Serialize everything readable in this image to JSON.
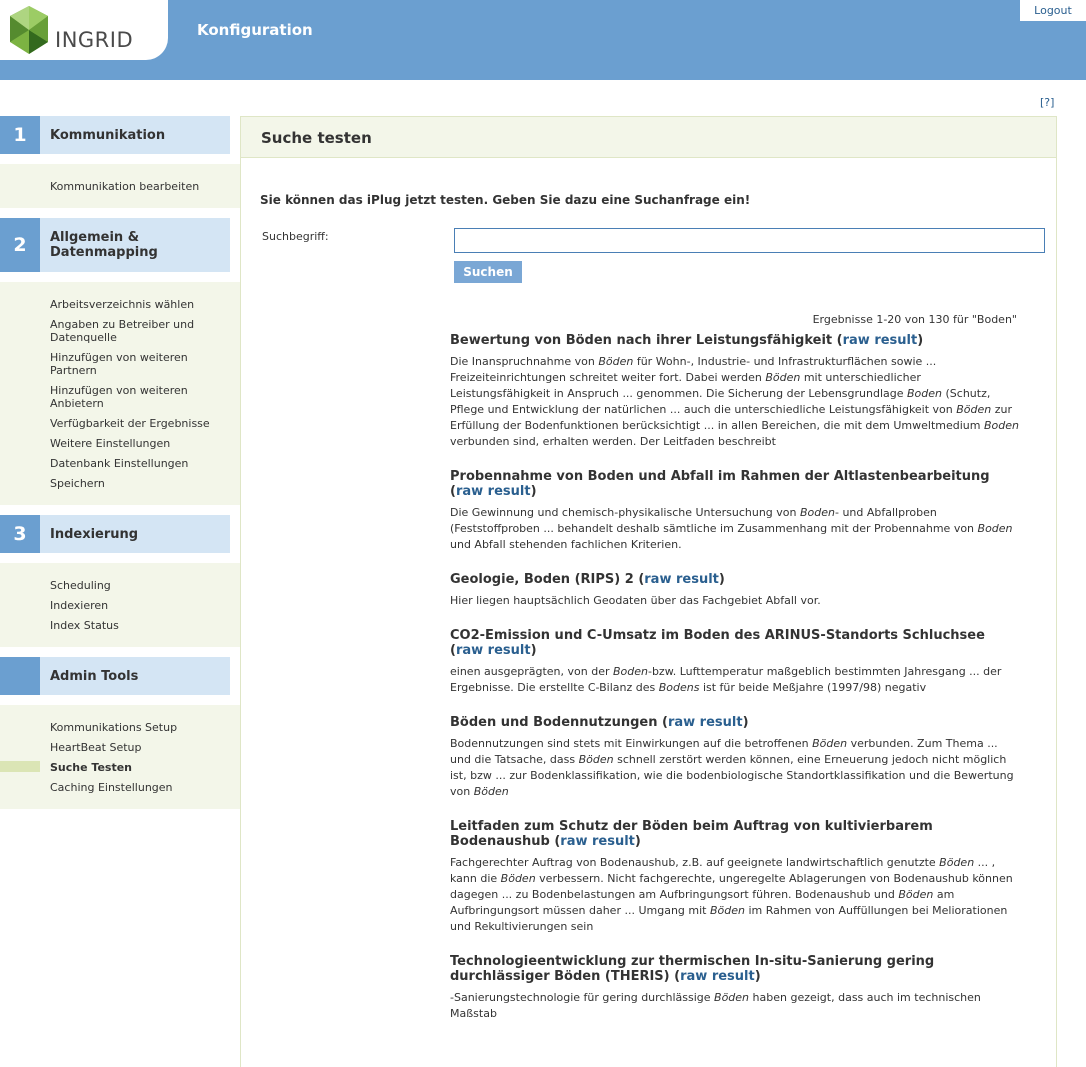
{
  "header": {
    "logo_text": "INGRID",
    "title": "Konfiguration",
    "logout": "Logout",
    "brand_colors": {
      "header": "#6b9fd0",
      "logo_green": "#7cb342"
    }
  },
  "help_link": "[?]",
  "sidebar": {
    "sections": [
      {
        "number": "1",
        "title": "Kommunikation",
        "items": [
          {
            "label": "Kommunikation bearbeiten",
            "active": false
          }
        ]
      },
      {
        "number": "2",
        "title": "Allgemein & Datenmapping",
        "items": [
          {
            "label": "Arbeitsverzeichnis wählen",
            "active": false
          },
          {
            "label": "Angaben zu Betreiber und Datenquelle",
            "active": false
          },
          {
            "label": "Hinzufügen von weiteren Partnern",
            "active": false
          },
          {
            "label": "Hinzufügen von weiteren Anbietern",
            "active": false
          },
          {
            "label": "Verfügbarkeit der Ergebnisse",
            "active": false
          },
          {
            "label": "Weitere Einstellungen",
            "active": false
          },
          {
            "label": "Datenbank Einstellungen",
            "active": false
          },
          {
            "label": "Speichern",
            "active": false
          }
        ]
      },
      {
        "number": "3",
        "title": "Indexierung",
        "items": [
          {
            "label": "Scheduling",
            "active": false
          },
          {
            "label": "Indexieren",
            "active": false
          },
          {
            "label": "Index Status",
            "active": false
          }
        ]
      },
      {
        "number": "",
        "title": "Admin Tools",
        "items": [
          {
            "label": "Kommunikations Setup",
            "active": false
          },
          {
            "label": "HeartBeat Setup",
            "active": false
          },
          {
            "label": "Suche Testen",
            "active": true
          },
          {
            "label": "Caching Einstellungen",
            "active": false
          }
        ]
      }
    ]
  },
  "main": {
    "heading": "Suche testen",
    "intro": "Sie können das iPlug jetzt testen. Geben Sie dazu eine Suchanfrage ein!",
    "search_label": "Suchbegriff:",
    "search_value": "",
    "search_button": "Suchen",
    "result_count": "Ergebnisse 1-20 von 130 für \"Boden\"",
    "raw_label": "raw result",
    "results": [
      {
        "title": "Bewertung von Böden nach ihrer Leistungsfähigkeit",
        "snippet": [
          {
            "t": "Die Inanspruchnahme von "
          },
          {
            "t": "Böden",
            "i": true
          },
          {
            "t": " für Wohn-, Industrie- und Infrastrukturflächen sowie ... Freizeiteinrichtungen schreitet weiter fort. Dabei werden "
          },
          {
            "t": "Böden",
            "i": true
          },
          {
            "t": " mit unterschiedlicher Leistungsfähigkeit in Anspruch ... genommen. Die Sicherung der Lebensgrundlage "
          },
          {
            "t": "Boden",
            "i": true
          },
          {
            "t": " (Schutz, Pflege und Entwicklung der natürlichen ... auch die unterschiedliche Leistungsfähigkeit von "
          },
          {
            "t": "Böden",
            "i": true
          },
          {
            "t": " zur Erfüllung der Bodenfunktionen berücksichtigt ... in allen Bereichen, die mit dem Umweltmedium "
          },
          {
            "t": "Boden",
            "i": true
          },
          {
            "t": " verbunden sind, erhalten werden. Der Leitfaden beschreibt"
          }
        ]
      },
      {
        "title": "Probennahme von Boden und Abfall im Rahmen der Altlastenbearbeitung",
        "snippet": [
          {
            "t": "Die Gewinnung und chemisch-physikalische Untersuchung von "
          },
          {
            "t": "Boden",
            "i": true
          },
          {
            "t": "- und Abfallproben (Feststoffproben ... behandelt deshalb sämtliche im Zusammenhang mit der Probennahme von "
          },
          {
            "t": "Boden",
            "i": true
          },
          {
            "t": " und Abfall stehenden fachlichen Kriterien."
          }
        ]
      },
      {
        "title": "Geologie, Boden (RIPS) 2",
        "snippet": [
          {
            "t": "Hier liegen hauptsächlich Geodaten über das Fachgebiet Abfall vor."
          }
        ]
      },
      {
        "title": "CO2-Emission und C-Umsatz im Boden des ARINUS-Standorts Schluchsee",
        "snippet": [
          {
            "t": "einen ausgeprägten, von der "
          },
          {
            "t": "Boden",
            "i": true
          },
          {
            "t": "-bzw. Lufttemperatur maßgeblich bestimmten Jahresgang ... der Ergebnisse. Die erstellte C-Bilanz des "
          },
          {
            "t": "Bodens",
            "i": true
          },
          {
            "t": " ist für beide Meßjahre (1997/98) negativ"
          }
        ]
      },
      {
        "title": "Böden und Bodennutzungen",
        "snippet": [
          {
            "t": "Bodennutzungen sind stets mit Einwirkungen auf die betroffenen "
          },
          {
            "t": "Böden",
            "i": true
          },
          {
            "t": " verbunden. Zum Thema ... und die Tatsache, dass "
          },
          {
            "t": "Böden",
            "i": true
          },
          {
            "t": " schnell zerstört werden können, eine Erneuerung jedoch nicht möglich ist, bzw ... zur Bodenklassifikation, wie die bodenbiologische Standortklassifikation und die Bewertung von "
          },
          {
            "t": "Böden",
            "i": true
          }
        ]
      },
      {
        "title": "Leitfaden zum Schutz der Böden beim Auftrag von kultivierbarem Bodenaushub",
        "snippet": [
          {
            "t": "Fachgerechter Auftrag von Bodenaushub, z.B. auf geeignete landwirtschaftlich genutzte "
          },
          {
            "t": "Böden",
            "i": true
          },
          {
            "t": " ... , kann die "
          },
          {
            "t": "Böden",
            "i": true
          },
          {
            "t": " verbessern. Nicht fachgerechte, ungeregelte Ablagerungen von Bodenaushub können dagegen ... zu Bodenbelastungen am Aufbringungsort führen. Bodenaushub und "
          },
          {
            "t": "Böden",
            "i": true
          },
          {
            "t": " am Aufbringungsort müssen daher ... Umgang mit "
          },
          {
            "t": "Böden",
            "i": true
          },
          {
            "t": " im Rahmen von Auffüllungen bei Meliorationen und Rekultivierungen sein"
          }
        ]
      },
      {
        "title": "Technologieentwicklung zur thermischen In-situ-Sanierung gering durchlässiger Böden (THERIS)",
        "snippet": [
          {
            "t": "-Sanierungstechnologie für gering durchlässige "
          },
          {
            "t": "Böden",
            "i": true
          },
          {
            "t": " haben gezeigt, dass auch im technischen Maßstab"
          }
        ]
      }
    ]
  }
}
